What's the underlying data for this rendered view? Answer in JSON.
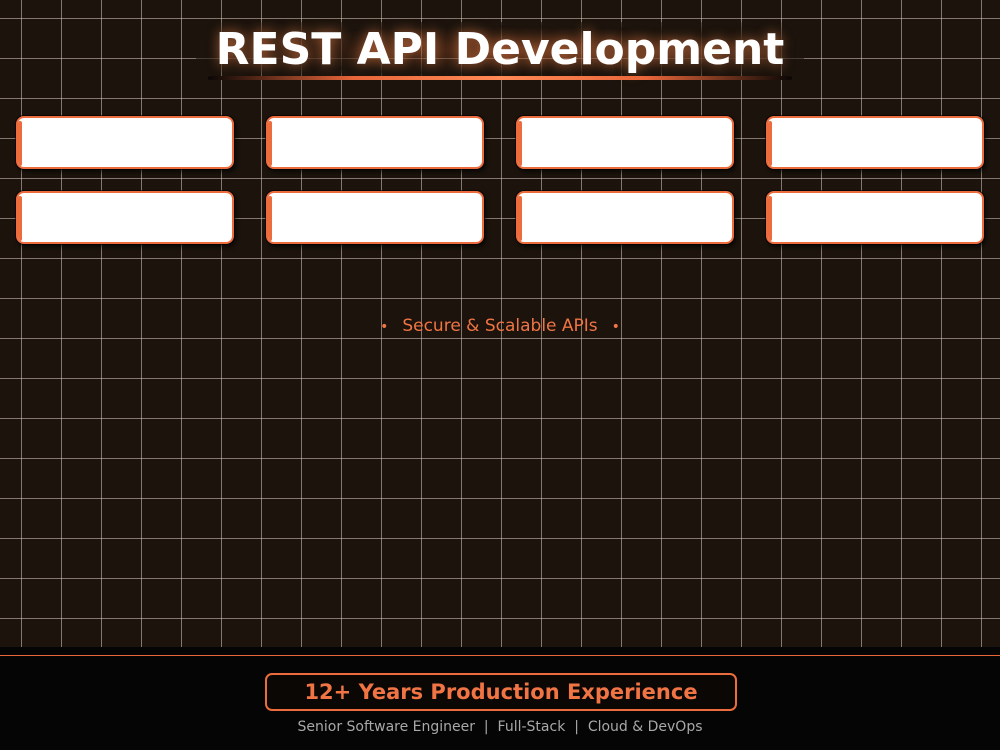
{
  "title": "REST API Development",
  "cards": [
    {
      "label": ""
    },
    {
      "label": ""
    },
    {
      "label": ""
    },
    {
      "label": ""
    },
    {
      "label": ""
    },
    {
      "label": ""
    },
    {
      "label": ""
    },
    {
      "label": ""
    }
  ],
  "tagline": {
    "bullet_left": "•",
    "text": "Secure & Scalable APIs",
    "bullet_right": "•"
  },
  "footer": {
    "badge": "12+ Years Production Experience",
    "subline": "Senior Software Engineer  |  Full-Stack  |  Cloud & DevOps"
  },
  "colors": {
    "accent": "#ec6c3e",
    "background": "#1b130c",
    "footer_bg": "#050505",
    "card_bg": "#ffffff",
    "subtext": "#a8a8a8"
  }
}
